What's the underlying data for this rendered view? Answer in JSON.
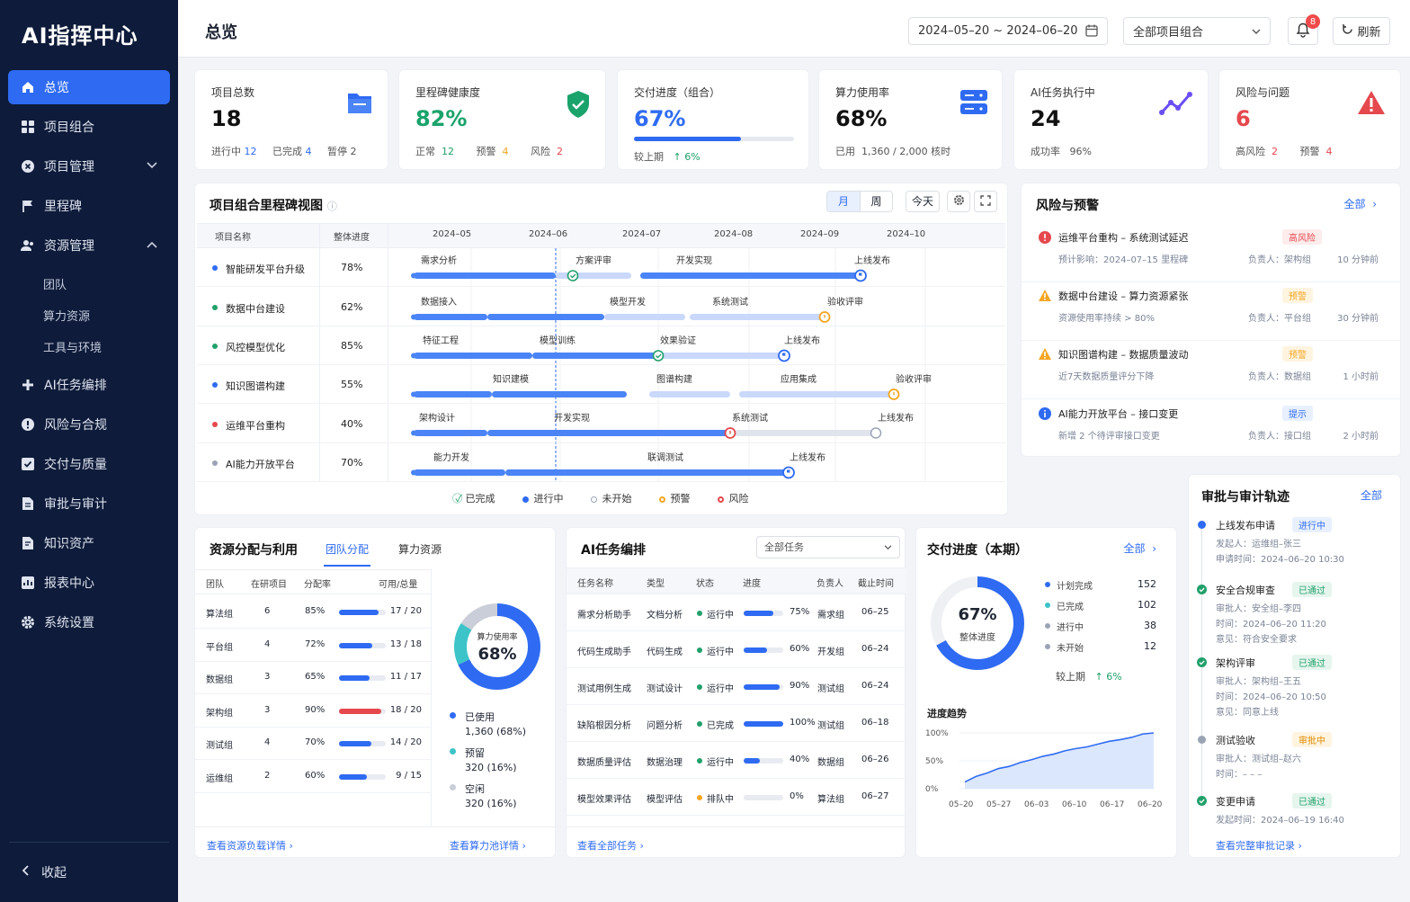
{
  "app": {
    "logo": "AI指挥中心",
    "collapse_label": "收起"
  },
  "nav": [
    {
      "label": "总览",
      "icon": "home-icon",
      "active": true
    },
    {
      "label": "项目组合",
      "icon": "grid-icon"
    },
    {
      "label": "项目管理",
      "icon": "folder-x-icon",
      "chevron": "down"
    },
    {
      "label": "里程碑",
      "icon": "flag-icon"
    },
    {
      "label": "资源管理",
      "icon": "users-icon",
      "chevron": "up"
    }
  ],
  "nav_sub": [
    "团队",
    "算力资源",
    "工具与环境"
  ],
  "nav2": [
    {
      "label": "AI任务编排",
      "icon": "plus-icon"
    },
    {
      "label": "风险与合规",
      "icon": "alert-icon"
    },
    {
      "label": "交付与质量",
      "icon": "check-square-icon"
    },
    {
      "label": "审批与审计",
      "icon": "doc-icon"
    },
    {
      "label": "知识资产",
      "icon": "book-icon"
    },
    {
      "label": "报表中心",
      "icon": "report-icon"
    },
    {
      "label": "系统设置",
      "icon": "gear-icon"
    }
  ],
  "header": {
    "title": "总览",
    "date_range": "2024–05–20 ~ 2024–06–20",
    "project_select": "全部项目组合",
    "notif_count": "8",
    "refresh_label": "刷新"
  },
  "kpis": {
    "projects": {
      "title": "项目总数",
      "value": "18",
      "l1": "进行中",
      "v1": "12",
      "l2": "已完成",
      "v2": "4",
      "l3": "暂停",
      "v3": "2"
    },
    "milestone": {
      "title": "里程碑健康度",
      "value": "82%",
      "l1": "正常",
      "v1": "12",
      "l2": "预警",
      "v2": "4",
      "l3": "风险",
      "v3": "2"
    },
    "delivery": {
      "title": "交付进度（组合）",
      "value": "67%",
      "progress": 0.67,
      "l1": "较上期",
      "v1": "↑ 6%"
    },
    "compute": {
      "title": "算力使用率",
      "value": "68%",
      "l1": "已用",
      "v1": "1,360 / 2,000 核时"
    },
    "ai_tasks": {
      "title": "AI任务执行中",
      "value": "24",
      "l1": "成功率",
      "v1": "96%"
    },
    "risks": {
      "title": "风险与问题",
      "value": "6",
      "l1": "高风险",
      "v1": "2",
      "l2": "预警",
      "v2": "4"
    }
  },
  "gantt": {
    "title": "项目组合里程碑视图",
    "view_month": "月",
    "view_week": "周",
    "today_label": "今天",
    "col_name": "项目名称",
    "col_progress": "整体进度",
    "months": [
      "2024–05",
      "2024–06",
      "2024–07",
      "2024–08",
      "2024–09",
      "2024–10"
    ],
    "rows": [
      {
        "name": "智能研发平台升级",
        "progress": "78%",
        "dot": "#2f6bf2",
        "labels": [
          "需求分析",
          "方案评审",
          "开发实现",
          "上线发布"
        ]
      },
      {
        "name": "数据中台建设",
        "progress": "62%",
        "dot": "#22a06b",
        "labels": [
          "数据接入",
          "模型开发",
          "系统测试",
          "验收评审"
        ]
      },
      {
        "name": "风控模型优化",
        "progress": "85%",
        "dot": "#22a06b",
        "labels": [
          "特征工程",
          "模型训练",
          "效果验证",
          "上线发布"
        ]
      },
      {
        "name": "知识图谱构建",
        "progress": "55%",
        "dot": "#2f6bf2",
        "labels": [
          "知识建模",
          "图谱构建",
          "应用集成",
          "验收评审"
        ]
      },
      {
        "name": "运维平台重构",
        "progress": "40%",
        "dot": "#e5484d",
        "labels": [
          "架构设计",
          "开发实现",
          "系统测试",
          "上线发布"
        ]
      },
      {
        "name": "AI能力开放平台",
        "progress": "70%",
        "dot": "#9aa3b5",
        "labels": [
          "能力开发",
          "联调测试",
          "上线发布"
        ]
      }
    ],
    "legend": [
      "已完成",
      "进行中",
      "未开始",
      "预警",
      "风险"
    ]
  },
  "risks": {
    "title": "风险与预警",
    "all_label": "全部",
    "items": [
      {
        "title": "运维平台重构 – 系统测试延迟",
        "tag": "高风险",
        "desc": "预计影响：2024–07–15 里程碑",
        "owner": "负责人：架构组",
        "time": "10 分钟前",
        "icon": "error-icon",
        "color": "#e5484d",
        "tagbg": "#fdecec"
      },
      {
        "title": "数据中台建设 – 算力资源紧张",
        "tag": "预警",
        "desc": "资源使用率持续 > 80%",
        "owner": "负责人：平台组",
        "time": "30 分钟前",
        "icon": "warning-icon",
        "color": "#f5a623",
        "tagbg": "#fff4e0"
      },
      {
        "title": "知识图谱构建 – 数据质量波动",
        "tag": "预警",
        "desc": "近7天数据质量评分下降",
        "owner": "负责人：数据组",
        "time": "1 小时前",
        "icon": "warning-icon",
        "color": "#f5a623",
        "tagbg": "#fff4e0"
      },
      {
        "title": "AI能力开放平台 – 接口变更",
        "tag": "提示",
        "desc": "新增 2 个待评审接口变更",
        "owner": "负责人：接口组",
        "time": "2 小时前",
        "icon": "info-icon",
        "color": "#2f6bf2",
        "tagbg": "#e8f0fe"
      }
    ]
  },
  "resource": {
    "title": "资源分配与利用",
    "tab1": "团队分配",
    "tab2": "算力资源",
    "cols": [
      "团队",
      "在研项目",
      "分配率",
      "可用/总量"
    ],
    "rows": [
      {
        "team": "算法组",
        "projects": "6",
        "rate": "85%",
        "pct": 0.85,
        "avail": "17 / 20",
        "color": "#2f6bf2"
      },
      {
        "team": "平台组",
        "projects": "4",
        "rate": "72%",
        "pct": 0.72,
        "avail": "13 / 18",
        "color": "#2f6bf2"
      },
      {
        "team": "数据组",
        "projects": "3",
        "rate": "65%",
        "pct": 0.65,
        "avail": "11 / 17",
        "color": "#2f6bf2"
      },
      {
        "team": "架构组",
        "projects": "3",
        "rate": "90%",
        "pct": 0.9,
        "avail": "18 / 20",
        "color": "#e5484d"
      },
      {
        "team": "测试组",
        "projects": "4",
        "rate": "70%",
        "pct": 0.7,
        "avail": "14 / 20",
        "color": "#2f6bf2"
      },
      {
        "team": "运维组",
        "projects": "2",
        "rate": "60%",
        "pct": 0.6,
        "avail": "9 / 15",
        "color": "#2f6bf2"
      }
    ],
    "donut_label": "算力使用率",
    "donut_value": "68%",
    "legend": [
      {
        "label": "已使用",
        "value": "1,360 (68%)",
        "color": "#2f6bf2",
        "pct": 0.68
      },
      {
        "label": "预留",
        "value": "320 (16%)",
        "color": "#3cc4c8",
        "pct": 0.16
      },
      {
        "label": "空闲",
        "value": "320 (16%)",
        "color": "#c9ced8",
        "pct": 0.16
      }
    ],
    "link1": "查看资源负载详情 ›",
    "link2": "查看算力池详情 ›"
  },
  "ai_tasks": {
    "title": "AI任务编排",
    "filter": "全部任务",
    "cols": [
      "任务名称",
      "类型",
      "状态",
      "进度",
      "负责人",
      "截止时间"
    ],
    "rows": [
      {
        "name": "需求分析助手",
        "type": "文档分析",
        "status": "运行中",
        "sc": "#22a06b",
        "progress": "75%",
        "pct": 0.75,
        "owner": "需求组",
        "due": "06–25"
      },
      {
        "name": "代码生成助手",
        "type": "代码生成",
        "status": "运行中",
        "sc": "#22a06b",
        "progress": "60%",
        "pct": 0.6,
        "owner": "开发组",
        "due": "06–24"
      },
      {
        "name": "测试用例生成",
        "type": "测试设计",
        "status": "运行中",
        "sc": "#22a06b",
        "progress": "90%",
        "pct": 0.9,
        "owner": "测试组",
        "due": "06–24"
      },
      {
        "name": "缺陷根因分析",
        "type": "问题分析",
        "status": "已完成",
        "sc": "#22a06b",
        "progress": "100%",
        "pct": 1.0,
        "owner": "测试组",
        "due": "06–18"
      },
      {
        "name": "数据质量评估",
        "type": "数据治理",
        "status": "运行中",
        "sc": "#22a06b",
        "progress": "40%",
        "pct": 0.4,
        "owner": "数据组",
        "due": "06–26"
      },
      {
        "name": "模型效果评估",
        "type": "模型评估",
        "status": "排队中",
        "sc": "#f5a623",
        "progress": "0%",
        "pct": 0.0,
        "owner": "算法组",
        "due": "06–27"
      }
    ],
    "link": "查看全部任务 ›"
  },
  "delivery": {
    "title": "交付进度（本期）",
    "all_label": "全部",
    "donut_value": "67%",
    "donut_label": "整体进度",
    "pct": 0.67,
    "stats": [
      {
        "label": "计划完成",
        "value": "152",
        "color": "#2f6bf2"
      },
      {
        "label": "已完成",
        "value": "102",
        "color": "#3cc4c8"
      },
      {
        "label": "进行中",
        "value": "38",
        "color": "#9aa3b5"
      },
      {
        "label": "未开始",
        "value": "12",
        "color": "#9aa3b5"
      }
    ],
    "compare_label": "较上期",
    "compare_value": "↑ 6%",
    "trend_title": "进度趋势"
  },
  "chart_data": {
    "type": "area",
    "title": "进度趋势",
    "x": [
      "05–20",
      "05–27",
      "06–03",
      "06–10",
      "06–17",
      "06–20"
    ],
    "y_ticks": [
      "100%",
      "50%",
      "0%"
    ],
    "ylim": [
      0,
      100
    ],
    "series": [
      {
        "values": [
          12,
          22,
          28,
          36,
          40,
          47,
          52,
          58,
          62,
          68,
          72,
          75,
          80,
          85,
          88,
          92,
          98,
          100
        ]
      }
    ]
  },
  "approvals": {
    "title": "审批与审计轨迹",
    "all_label": "全部",
    "items": [
      {
        "title": "上线发布申请",
        "tag": "进行中",
        "tagc": "#2f6bf2",
        "tagbg": "#e8f0fe",
        "dot": "#2f6bf2",
        "lines": [
          "发起人：运维组–张三",
          "申请时间：2024–06–20 10:30"
        ]
      },
      {
        "title": "安全合规审查",
        "tag": "已通过",
        "tagc": "#22a06b",
        "tagbg": "#e6f6ee",
        "dot": "#22a06b",
        "lines": [
          "审批人：安全组–李四",
          "时间：2024–06–20 11:20",
          "意见：符合安全要求"
        ]
      },
      {
        "title": "架构评审",
        "tag": "已通过",
        "tagc": "#22a06b",
        "tagbg": "#e6f6ee",
        "dot": "#22a06b",
        "lines": [
          "审批人：架构组–王五",
          "时间：2024–06–20 10:50",
          "意见：同意上线"
        ]
      },
      {
        "title": "测试验收",
        "tag": "审批中",
        "tagc": "#e08a00",
        "tagbg": "#fff4e0",
        "dot": "#9aa3b5",
        "lines": [
          "审批人：测试组–赵六",
          "时间：– – –"
        ]
      },
      {
        "title": "变更申请",
        "tag": "已通过",
        "tagc": "#22a06b",
        "tagbg": "#e6f6ee",
        "dot": "#22a06b",
        "lines": [
          "发起时间：2024–06–19 16:40"
        ]
      }
    ],
    "link": "查看完整审批记录 ›"
  },
  "colors": {
    "accent": "#2f6bf2",
    "sidebar": "#0e1b3a",
    "green": "#22a06b",
    "red": "#e5484d",
    "orange": "#f5a623"
  }
}
